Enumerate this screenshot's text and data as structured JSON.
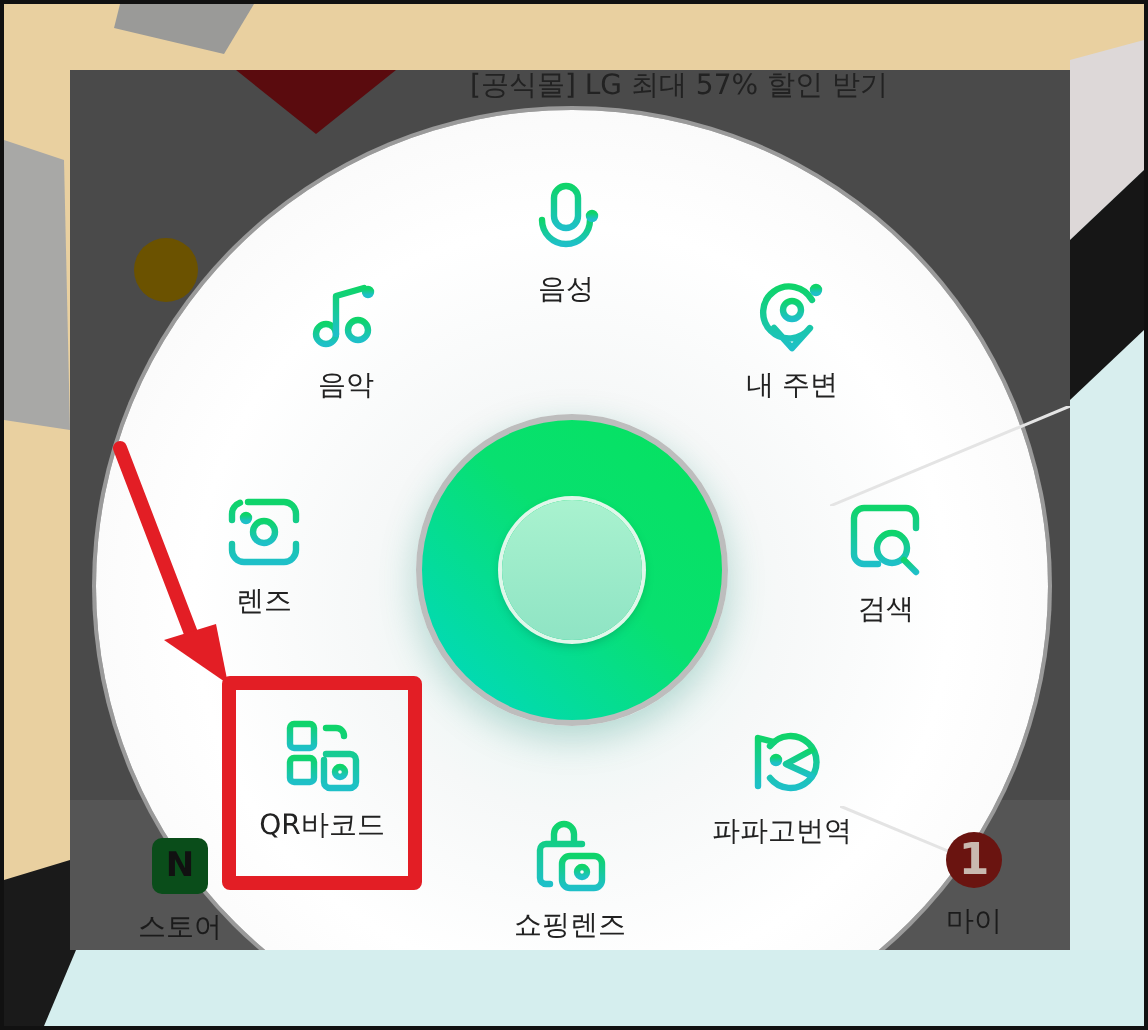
{
  "banner": {
    "text": "[공식몰] LG 최대 57% 할인 받기"
  },
  "menu_items": [
    {
      "label": "음성",
      "highlighted": false
    },
    {
      "label": "음악",
      "highlighted": false
    },
    {
      "label": "내 주변",
      "highlighted": false
    },
    {
      "label": "렌즈",
      "highlighted": false
    },
    {
      "label": "검색",
      "highlighted": false
    },
    {
      "label": "QR바코드",
      "highlighted": true
    },
    {
      "label": "쇼핑렌즈",
      "highlighted": false
    },
    {
      "label": "파파고번역",
      "highlighted": false
    }
  ],
  "bottom_bar": [
    {
      "label": "스토어",
      "badge": "N"
    },
    {
      "label": "마이",
      "badge": "1"
    }
  ]
}
